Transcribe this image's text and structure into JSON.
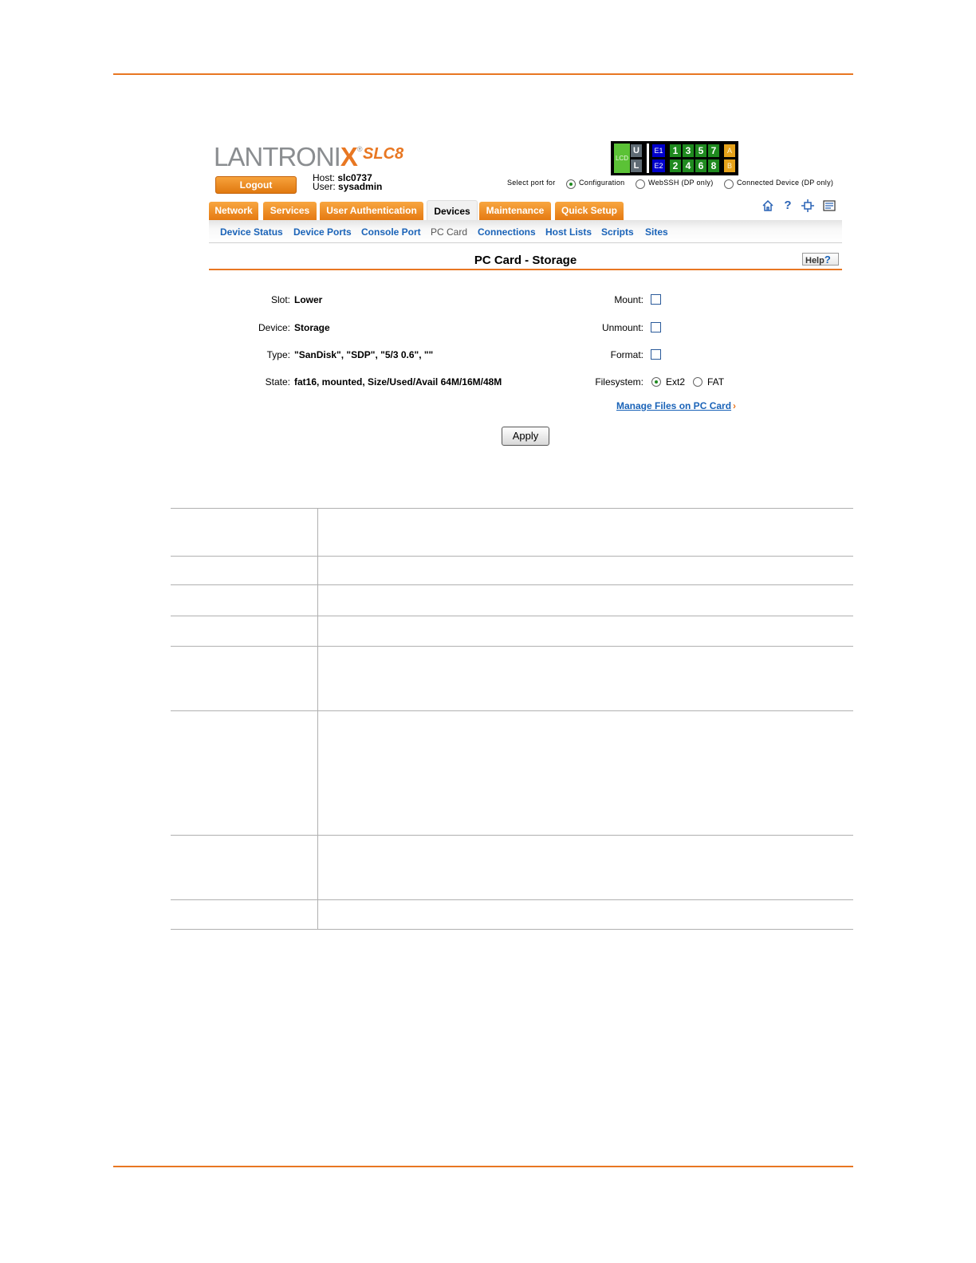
{
  "header": {
    "brand": "LANTRONI",
    "brand_x": "X",
    "brand_reg": "®",
    "model": "SLC8",
    "logout_label": "Logout",
    "host_label": "Host:",
    "host_value": "slc0737",
    "user_label": "User:",
    "user_value": "sysadmin"
  },
  "ports": {
    "lcd": "LCD",
    "u": "U",
    "l": "L",
    "e1": "E1",
    "e2": "E2",
    "top_row": [
      "1",
      "3",
      "5",
      "7"
    ],
    "bottom_row": [
      "2",
      "4",
      "6",
      "8"
    ],
    "a": "A",
    "b": "B"
  },
  "select_port": {
    "label": "Select port for",
    "options": [
      "Configuration",
      "WebSSH (DP only)",
      "Connected Device (DP only)"
    ],
    "selected": "Configuration"
  },
  "tabs": [
    "Network",
    "Services",
    "User Authentication",
    "Devices",
    "Maintenance",
    "Quick Setup"
  ],
  "active_tab": "Devices",
  "toolbar_icons": [
    "home-icon",
    "help-icon",
    "sitemap-icon",
    "log-icon"
  ],
  "subnav": [
    "Device Status",
    "Device Ports",
    "Console Port",
    "PC Card",
    "Connections",
    "Host Lists",
    "Scripts",
    "Sites"
  ],
  "active_subnav": "PC Card",
  "page": {
    "title": "PC Card - Storage",
    "help_label": "Help",
    "help_mark": "?"
  },
  "form": {
    "slot_label": "Slot:",
    "slot_value": "Lower",
    "device_label": "Device:",
    "device_value": "Storage",
    "type_label": "Type:",
    "type_value": "\"SanDisk\", \"SDP\", \"5/3 0.6\", \"\"",
    "state_label": "State:",
    "state_value": "fat16, mounted, Size/Used/Avail 64M/16M/48M",
    "mount_label": "Mount:",
    "unmount_label": "Unmount:",
    "format_label": "Format:",
    "filesystem_label": "Filesystem:",
    "fs_options": [
      "Ext2",
      "FAT"
    ],
    "fs_selected": "Ext2",
    "manage_link": "Manage Files on PC Card",
    "apply_label": "Apply"
  }
}
